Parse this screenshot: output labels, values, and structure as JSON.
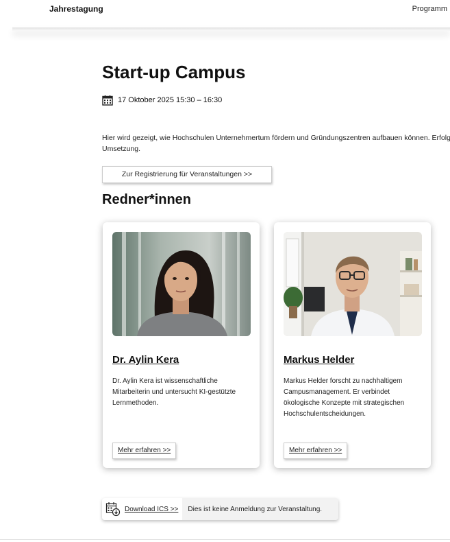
{
  "nav": {
    "brand": "Jahrestagung",
    "link": "Programm"
  },
  "event": {
    "title": "Start-up Campus",
    "date": "17 Oktober 2025 15:30  –  16:30",
    "description_line1": "Hier wird gezeigt, wie Hochschulen Unternehmertum fördern und Gründungszentren aufbauen können. Erfolg",
    "description_line2": "Umsetzung.",
    "register_label": "Zur Registrierung für Veranstaltungen >>"
  },
  "speakers_heading": "Redner*innen",
  "speakers": [
    {
      "name": "Dr. Aylin Kera",
      "bio": "Dr. Aylin Kera ist wissenschaftliche Mitarbeiterin und untersucht KI-gestützte Lernmethoden.",
      "more_label": "Mehr erfahren >>"
    },
    {
      "name": "Markus Helder",
      "bio": "Markus Helder forscht zu nachhaltigem Campusmanagement. Er verbindet ökologische Konzepte mit strategischen Hochschulentscheidungen.",
      "more_label": "Mehr erfahren >>"
    }
  ],
  "ics": {
    "button_label": "Download ICS >>",
    "note": "Dies ist keine Anmeldung zur Veranstaltung."
  },
  "icons": {
    "calendar": "calendar-icon",
    "ics": "calendar-download-icon"
  }
}
